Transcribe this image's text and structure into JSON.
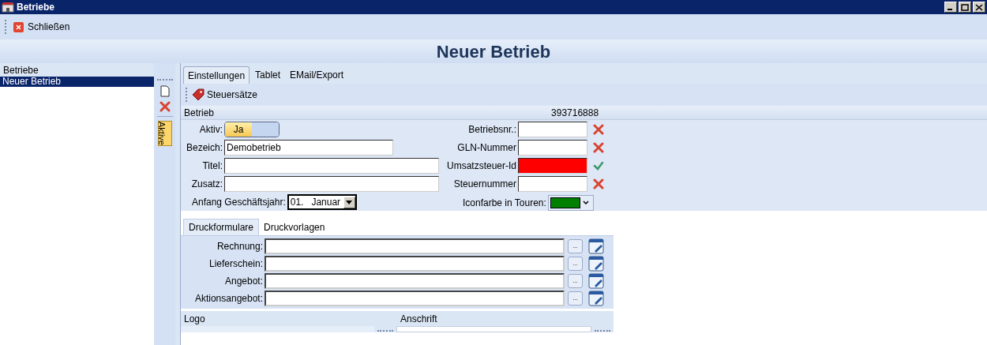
{
  "window": {
    "title": "Betriebe"
  },
  "toolbar": {
    "items": [
      {
        "label": "Schließen"
      }
    ]
  },
  "heading": "Neuer Betrieb",
  "sidebar": {
    "title": "Betriebe",
    "items": [
      {
        "label": "Neuer Betrieb",
        "selected": true
      }
    ],
    "side_tabs": [
      {
        "label": "Aktive",
        "selected": true
      }
    ]
  },
  "tabs": [
    {
      "label": "Einstellungen",
      "selected": true
    },
    {
      "label": "Tablet",
      "selected": false
    },
    {
      "label": "EMail/Export",
      "selected": false
    }
  ],
  "subtoolbar": {
    "items": [
      {
        "label": "Steuersätze"
      }
    ]
  },
  "section": {
    "title": "Betrieb",
    "number": "393716888"
  },
  "left_fields": [
    {
      "kind": "toggle",
      "label": "Aktiv:",
      "value": "Ja",
      "on": true
    },
    {
      "kind": "short_text",
      "label": "Bezeich:",
      "value": "Demobetrieb"
    },
    {
      "kind": "long_text",
      "label": "Titel:"
    },
    {
      "kind": "long_text",
      "label": "Zusatz:"
    },
    {
      "kind": "select",
      "label": "Anfang Geschäftsjahr:",
      "value": "01.   Januar"
    }
  ],
  "right_fields": [
    {
      "label": "Betriebsnr.:",
      "highlighted": false,
      "valid": false
    },
    {
      "label": "GLN-Nummer",
      "highlighted": false,
      "valid": false
    },
    {
      "label": "Umsatzsteuer-Id",
      "highlighted": true,
      "valid": true
    },
    {
      "label": "Steuernummer",
      "highlighted": false,
      "valid": false
    }
  ],
  "icon_color": {
    "label": "Iconfarbe in Touren:",
    "color": "#008000"
  },
  "print_tabs": [
    {
      "label": "Druckformulare",
      "selected": true
    },
    {
      "label": "Druckvorlagen",
      "selected": false
    }
  ],
  "print_forms": [
    {
      "label": "Rechnung:",
      "button": "..."
    },
    {
      "label": "Lieferschein:",
      "button": "..."
    },
    {
      "label": "Angebot:",
      "button": "..."
    },
    {
      "label": "Aktionsangebot:",
      "button": "..."
    }
  ],
  "bottom_panels": [
    {
      "title": "Logo"
    },
    {
      "title": "Anschrift"
    }
  ]
}
